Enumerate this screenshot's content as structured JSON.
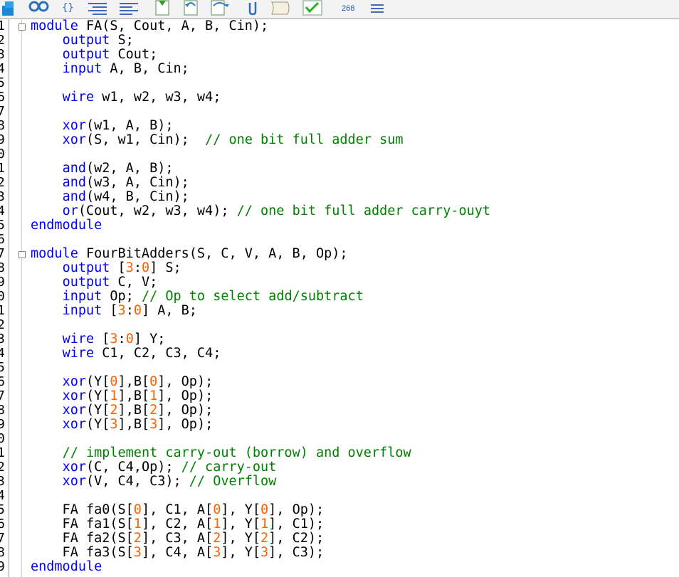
{
  "toolbar": {
    "counter": "268"
  },
  "colors": {
    "keyword": "#0000ff",
    "comment": "#008000",
    "number": "#ff6000",
    "text": "#000000"
  },
  "gutter": {
    "line_digits": [
      "1",
      "2",
      "3",
      "4",
      "5",
      "6",
      "7",
      "8",
      "9",
      "0",
      "1",
      "2",
      "3",
      "4",
      "5",
      "6",
      "7",
      "8",
      "9",
      "0",
      "1",
      "2",
      "3",
      "4",
      "5",
      "6",
      "7",
      "8",
      "9",
      "0",
      "1",
      "2",
      "3",
      "4",
      "5",
      "6",
      "7",
      "8",
      "9"
    ]
  },
  "code": {
    "lines": [
      [
        {
          "t": "module",
          "c": "kw"
        },
        {
          "t": " FA(S, Cout, A, B, Cin);"
        }
      ],
      [
        {
          "t": "    "
        },
        {
          "t": "output",
          "c": "kw"
        },
        {
          "t": " S;"
        }
      ],
      [
        {
          "t": "    "
        },
        {
          "t": "output",
          "c": "kw"
        },
        {
          "t": " Cout;"
        }
      ],
      [
        {
          "t": "    "
        },
        {
          "t": "input",
          "c": "kw"
        },
        {
          "t": " A, B, Cin;"
        }
      ],
      [],
      [
        {
          "t": "    "
        },
        {
          "t": "wire",
          "c": "kw"
        },
        {
          "t": " w1, w2, w3, w4;"
        }
      ],
      [],
      [
        {
          "t": "    "
        },
        {
          "t": "xor",
          "c": "kw"
        },
        {
          "t": "(w1, A, B);"
        }
      ],
      [
        {
          "t": "    "
        },
        {
          "t": "xor",
          "c": "kw"
        },
        {
          "t": "(S, w1, Cin);  "
        },
        {
          "t": "// one bit full adder sum",
          "c": "cm"
        }
      ],
      [],
      [
        {
          "t": "    "
        },
        {
          "t": "and",
          "c": "kw"
        },
        {
          "t": "(w2, A, B);"
        }
      ],
      [
        {
          "t": "    "
        },
        {
          "t": "and",
          "c": "kw"
        },
        {
          "t": "(w3, A, Cin);"
        }
      ],
      [
        {
          "t": "    "
        },
        {
          "t": "and",
          "c": "kw"
        },
        {
          "t": "(w4, B, Cin);"
        }
      ],
      [
        {
          "t": "    "
        },
        {
          "t": "or",
          "c": "kw"
        },
        {
          "t": "(Cout, w2, w3, w4); "
        },
        {
          "t": "// one bit full adder carry-ouyt",
          "c": "cm"
        }
      ],
      [
        {
          "t": "endmodule",
          "c": "kw"
        }
      ],
      [],
      [
        {
          "t": "module",
          "c": "kw"
        },
        {
          "t": " FourBitAdders(S, C, V, A, B, Op);"
        }
      ],
      [
        {
          "t": "    "
        },
        {
          "t": "output",
          "c": "kw"
        },
        {
          "t": " ["
        },
        {
          "t": "3",
          "c": "num"
        },
        {
          "t": ":"
        },
        {
          "t": "0",
          "c": "num"
        },
        {
          "t": "] S;"
        }
      ],
      [
        {
          "t": "    "
        },
        {
          "t": "output",
          "c": "kw"
        },
        {
          "t": " C, V;"
        }
      ],
      [
        {
          "t": "    "
        },
        {
          "t": "input",
          "c": "kw"
        },
        {
          "t": " Op; "
        },
        {
          "t": "// Op to select add/subtract",
          "c": "cm"
        }
      ],
      [
        {
          "t": "    "
        },
        {
          "t": "input",
          "c": "kw"
        },
        {
          "t": " ["
        },
        {
          "t": "3",
          "c": "num"
        },
        {
          "t": ":"
        },
        {
          "t": "0",
          "c": "num"
        },
        {
          "t": "] A, B;"
        }
      ],
      [],
      [
        {
          "t": "    "
        },
        {
          "t": "wire",
          "c": "kw"
        },
        {
          "t": " ["
        },
        {
          "t": "3",
          "c": "num"
        },
        {
          "t": ":"
        },
        {
          "t": "0",
          "c": "num"
        },
        {
          "t": "] Y;"
        }
      ],
      [
        {
          "t": "    "
        },
        {
          "t": "wire",
          "c": "kw"
        },
        {
          "t": " C1, C2, C3, C4;"
        }
      ],
      [],
      [
        {
          "t": "    "
        },
        {
          "t": "xor",
          "c": "kw"
        },
        {
          "t": "(Y["
        },
        {
          "t": "0",
          "c": "num"
        },
        {
          "t": "],B["
        },
        {
          "t": "0",
          "c": "num"
        },
        {
          "t": "], Op);"
        }
      ],
      [
        {
          "t": "    "
        },
        {
          "t": "xor",
          "c": "kw"
        },
        {
          "t": "(Y["
        },
        {
          "t": "1",
          "c": "num"
        },
        {
          "t": "],B["
        },
        {
          "t": "1",
          "c": "num"
        },
        {
          "t": "], Op);"
        }
      ],
      [
        {
          "t": "    "
        },
        {
          "t": "xor",
          "c": "kw"
        },
        {
          "t": "(Y["
        },
        {
          "t": "2",
          "c": "num"
        },
        {
          "t": "],B["
        },
        {
          "t": "2",
          "c": "num"
        },
        {
          "t": "], Op);"
        }
      ],
      [
        {
          "t": "    "
        },
        {
          "t": "xor",
          "c": "kw"
        },
        {
          "t": "(Y["
        },
        {
          "t": "3",
          "c": "num"
        },
        {
          "t": "],B["
        },
        {
          "t": "3",
          "c": "num"
        },
        {
          "t": "], Op);"
        }
      ],
      [],
      [
        {
          "t": "    "
        },
        {
          "t": "// implement carry-out (borrow) and overflow",
          "c": "cm"
        }
      ],
      [
        {
          "t": "    "
        },
        {
          "t": "xor",
          "c": "kw"
        },
        {
          "t": "(C, C4,Op); "
        },
        {
          "t": "// carry-out",
          "c": "cm"
        }
      ],
      [
        {
          "t": "    "
        },
        {
          "t": "xor",
          "c": "kw"
        },
        {
          "t": "(V, C4, C3); "
        },
        {
          "t": "// Overflow",
          "c": "cm"
        }
      ],
      [],
      [
        {
          "t": "    FA fa0(S["
        },
        {
          "t": "0",
          "c": "num"
        },
        {
          "t": "], C1, A["
        },
        {
          "t": "0",
          "c": "num"
        },
        {
          "t": "], Y["
        },
        {
          "t": "0",
          "c": "num"
        },
        {
          "t": "], Op);"
        }
      ],
      [
        {
          "t": "    FA fa1(S["
        },
        {
          "t": "1",
          "c": "num"
        },
        {
          "t": "], C2, A["
        },
        {
          "t": "1",
          "c": "num"
        },
        {
          "t": "], Y["
        },
        {
          "t": "1",
          "c": "num"
        },
        {
          "t": "], C1);"
        }
      ],
      [
        {
          "t": "    FA fa2(S["
        },
        {
          "t": "2",
          "c": "num"
        },
        {
          "t": "], C3, A["
        },
        {
          "t": "2",
          "c": "num"
        },
        {
          "t": "], Y["
        },
        {
          "t": "2",
          "c": "num"
        },
        {
          "t": "], C2);"
        }
      ],
      [
        {
          "t": "    FA fa3(S["
        },
        {
          "t": "3",
          "c": "num"
        },
        {
          "t": "], C4, A["
        },
        {
          "t": "3",
          "c": "num"
        },
        {
          "t": "], Y["
        },
        {
          "t": "3",
          "c": "num"
        },
        {
          "t": "], C3);"
        }
      ],
      [
        {
          "t": "endmodule",
          "c": "kw"
        }
      ]
    ]
  }
}
